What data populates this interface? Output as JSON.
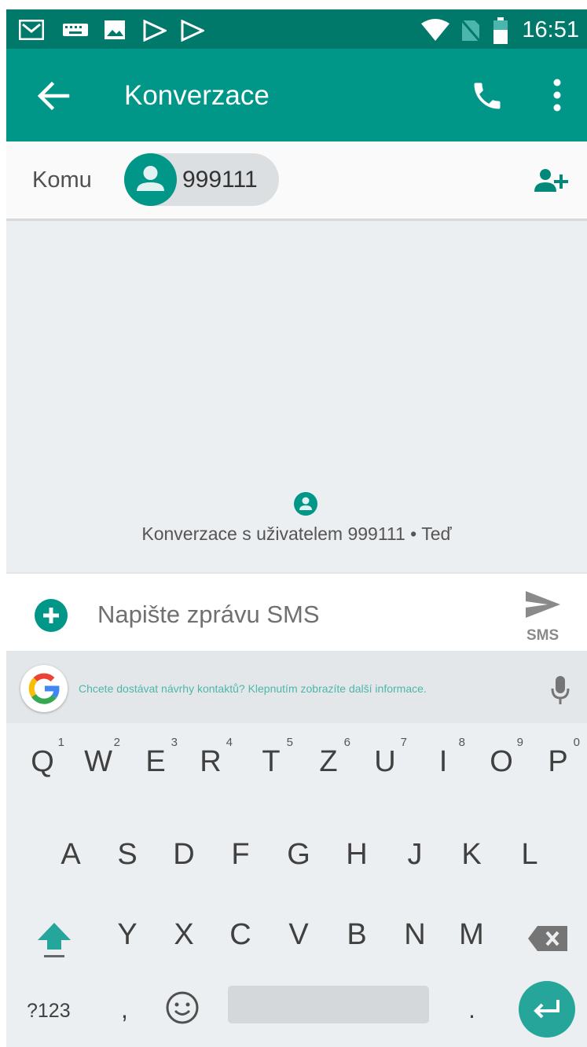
{
  "status_bar": {
    "time": "16:51",
    "left_icons": [
      "gmail-icon",
      "keyboard-icon",
      "image-icon",
      "play-store-icon",
      "play-store-icon"
    ],
    "right_icons": [
      "wifi-icon",
      "no-sim-icon",
      "battery-icon"
    ]
  },
  "app_bar": {
    "title": "Konverzace",
    "back_icon": "arrow-back-icon",
    "call_icon": "phone-icon",
    "menu_icon": "more-vert-icon"
  },
  "recipient_bar": {
    "label": "Komu",
    "chip_number": "999111",
    "add_icon": "add-person-icon"
  },
  "conversation": {
    "info_text": "Konverzace s uživatelem 999111 • Teď"
  },
  "compose": {
    "placeholder": "Napište zprávu SMS",
    "send_label": "SMS"
  },
  "suggestion_bar": {
    "hint": "Chcete dostávat návrhy kontaktů? Klepnutím zobrazíte další informace."
  },
  "keyboard": {
    "row1": [
      {
        "key": "Q",
        "hint": "1"
      },
      {
        "key": "W",
        "hint": "2"
      },
      {
        "key": "E",
        "hint": "3"
      },
      {
        "key": "R",
        "hint": "4"
      },
      {
        "key": "T",
        "hint": "5"
      },
      {
        "key": "Z",
        "hint": "6"
      },
      {
        "key": "U",
        "hint": "7"
      },
      {
        "key": "I",
        "hint": "8"
      },
      {
        "key": "O",
        "hint": "9"
      },
      {
        "key": "P",
        "hint": "0"
      }
    ],
    "row2": [
      "A",
      "S",
      "D",
      "F",
      "G",
      "H",
      "J",
      "K",
      "L"
    ],
    "row3": [
      "Y",
      "X",
      "C",
      "V",
      "B",
      "N",
      "M"
    ],
    "mode_label": "?123",
    "comma": ",",
    "period": "."
  },
  "colors": {
    "primary": "#009688",
    "primary_dark": "#00796b",
    "accent": "#26a69a"
  }
}
